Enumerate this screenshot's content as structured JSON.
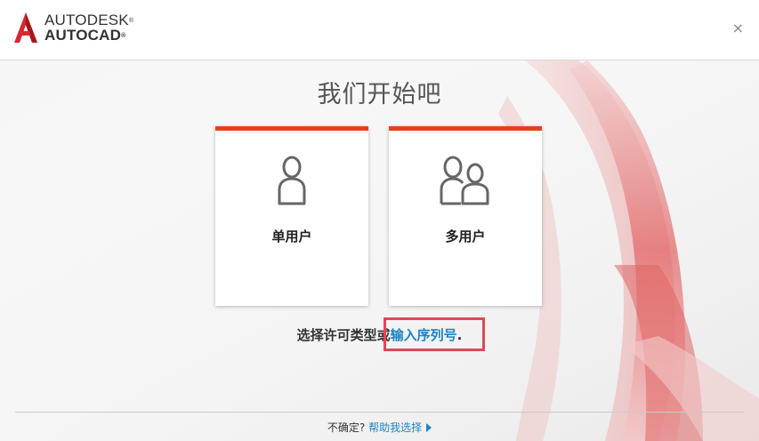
{
  "header": {
    "brand_line1": "AUTODESK",
    "brand_line2": "AUTOCAD",
    "close_label": "×"
  },
  "main": {
    "heading": "我们开始吧",
    "cards": [
      {
        "label": "单用户",
        "icon": "single-user-icon"
      },
      {
        "label": "多用户",
        "icon": "multi-user-icon"
      }
    ],
    "serial_prefix": "选择许可类型或",
    "serial_link": "输入序列号",
    "serial_suffix": "."
  },
  "footer": {
    "question": "不确定?",
    "help_link": "帮助我选择"
  },
  "colors": {
    "accent": "#e8401c",
    "link": "#1a84c7",
    "highlight": "#e0475a"
  }
}
